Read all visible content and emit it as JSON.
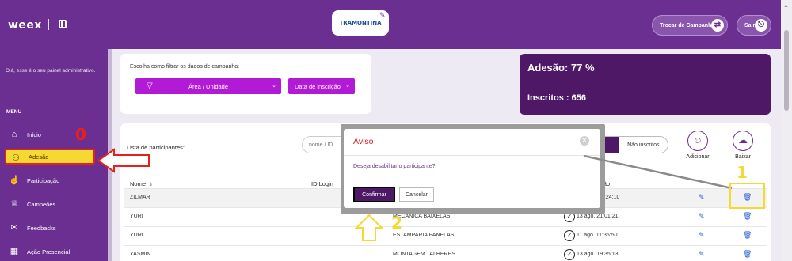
{
  "header": {
    "logo": "weex",
    "brand": "TRAMONTINA",
    "change_campaign_label": "Trocar de Campanha",
    "logout_label": "Sair"
  },
  "sidebar": {
    "welcome": "Olá, esse é o seu painel administrativo.",
    "menu_title": "MENU",
    "items": [
      {
        "label": "Início",
        "icon": "home-icon"
      },
      {
        "label": "Adesão",
        "icon": "people-icon",
        "active": true
      },
      {
        "label": "Participação",
        "icon": "touch-icon"
      },
      {
        "label": "Campeões",
        "icon": "trophy-icon"
      },
      {
        "label": "Feedbacks",
        "icon": "chat-icon"
      },
      {
        "label": "Ação Presencial",
        "icon": "qr-icon"
      }
    ]
  },
  "filter": {
    "title": "Escolha como filtrar os dados de campanha:",
    "area_label": "Área / Unidade",
    "date_label": "Data de inscrição"
  },
  "stats": {
    "adesao": "Adesão: 77 %",
    "inscritos": "Inscritos : 656"
  },
  "list": {
    "title": "Lista de participantes:",
    "search_placeholder": "nome / ID",
    "toggle_off": "Não inscritos",
    "add_label": "Adicionar",
    "download_label": "Baixar",
    "columns": {
      "name": "Nome",
      "id_login": "ID Login",
      "date_fragment": "ção"
    },
    "rows": [
      {
        "name": "ZILMAR",
        "area": "",
        "date": "2:24:10"
      },
      {
        "name": "YURI",
        "area": "MECANICA BAIXELAS",
        "date": "13 ago. 21:01:21"
      },
      {
        "name": "YURI",
        "area": "ESTAMPARIA PANELAS",
        "date": "11 ago. 11:35:50"
      },
      {
        "name": "YASMIN",
        "area": "MONTAGEM TALHERES",
        "date": "13 ago. 19:35:13"
      }
    ]
  },
  "modal": {
    "title": "Aviso",
    "message": "Deseja desabilitar o participante?",
    "confirm_label": "Confirmar",
    "cancel_label": "Cancelar"
  },
  "annotations": {
    "step0": "0",
    "step1": "1",
    "step2": "2"
  },
  "colors": {
    "primary": "#6b2f91",
    "dark": "#4f1866",
    "accent": "#b11bd6",
    "highlight": "#f4d932",
    "annotation_red": "#e8201a"
  }
}
